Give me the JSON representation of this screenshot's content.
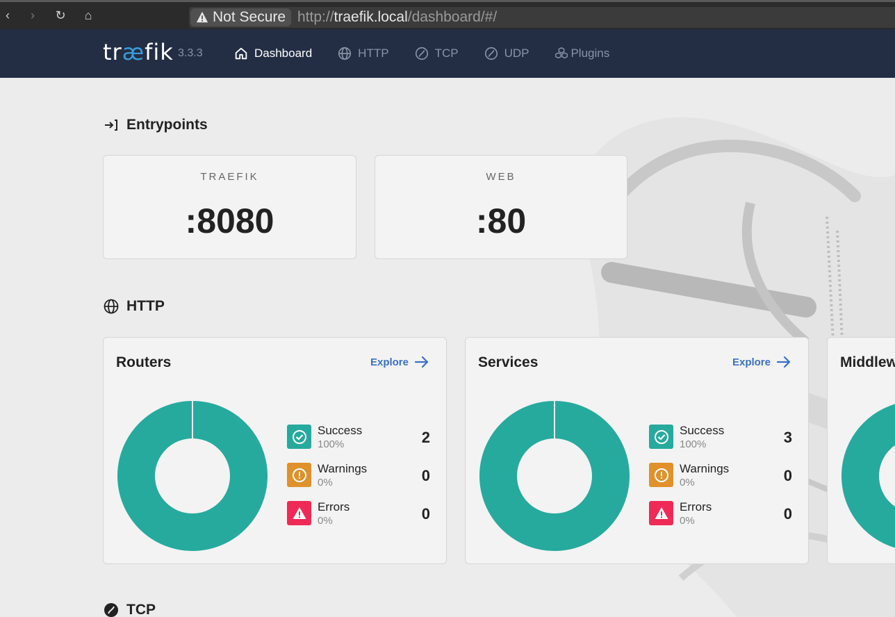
{
  "browser": {
    "security_label": "Not Secure",
    "url_scheme": "http://",
    "url_host": "traefik.local",
    "url_path": "/dashboard/#/"
  },
  "header": {
    "logo": "træfik",
    "version": "3.3.3",
    "nav": [
      {
        "label": "Dashboard",
        "icon": "home-icon",
        "active": true
      },
      {
        "label": "HTTP",
        "icon": "globe-icon",
        "active": false
      },
      {
        "label": "TCP",
        "icon": "tcp-icon",
        "active": false
      },
      {
        "label": "UDP",
        "icon": "udp-icon",
        "active": false
      },
      {
        "label": "Plugins",
        "icon": "cubes-icon",
        "active": false
      }
    ]
  },
  "entrypoints": {
    "title": "Entrypoints",
    "items": [
      {
        "name": "TRAEFIK",
        "port": ":8080"
      },
      {
        "name": "WEB",
        "port": ":80"
      }
    ]
  },
  "http": {
    "title": "HTTP",
    "explore_label": "Explore",
    "cards": [
      {
        "title": "Routers",
        "stats": [
          {
            "label": "Success",
            "percent": "100%",
            "count": "2"
          },
          {
            "label": "Warnings",
            "percent": "0%",
            "count": "0"
          },
          {
            "label": "Errors",
            "percent": "0%",
            "count": "0"
          }
        ]
      },
      {
        "title": "Services",
        "stats": [
          {
            "label": "Success",
            "percent": "100%",
            "count": "3"
          },
          {
            "label": "Warnings",
            "percent": "0%",
            "count": "0"
          },
          {
            "label": "Errors",
            "percent": "0%",
            "count": "0"
          }
        ]
      },
      {
        "title": "Middlew"
      }
    ]
  },
  "tcp": {
    "title": "TCP"
  },
  "colors": {
    "success": "#26aa9e",
    "warning": "#e0912b",
    "error": "#ef2a56",
    "header_bg": "#232e45",
    "link": "#3a6fc8"
  }
}
